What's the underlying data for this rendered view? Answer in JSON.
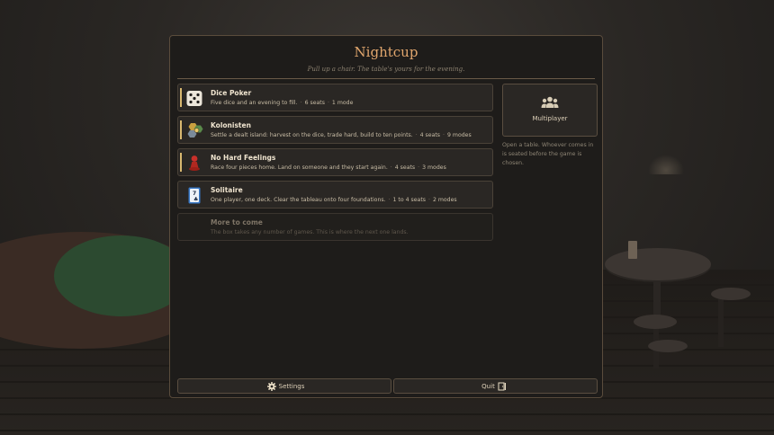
{
  "app": {
    "title": "Nightcup",
    "subtitle": "Pull up a chair. The table's yours for the evening."
  },
  "games": [
    {
      "name": "Dice Poker",
      "description": "Five dice and an evening to fill.",
      "seats": "6 seats",
      "modes": "1 mode",
      "icon": "dice-icon",
      "accent_color": "#d8b870"
    },
    {
      "name": "Kolonisten",
      "description": "Settle a dealt island: harvest on the dice, trade hard, build to ten points.",
      "seats": "4 seats",
      "modes": "9 modes",
      "icon": "hex-tiles-icon",
      "accent_color": "#d8b870"
    },
    {
      "name": "No Hard Feelings",
      "description": "Race four pieces home. Land on someone and they start again.",
      "seats": "4 seats",
      "modes": "3 modes",
      "icon": "pawn-icon",
      "accent_color": "#d8b870"
    },
    {
      "name": "Solitaire",
      "description": "One player, one deck. Clear the tableau onto four foundations.",
      "seats": "1 to 4 seats",
      "modes": "2 modes",
      "icon": "playing-card-icon",
      "accent_color": ""
    }
  ],
  "placeholder": {
    "name": "More to come",
    "description": "The box takes any number of games. This is where the next one lands."
  },
  "multiplayer": {
    "label": "Multiplayer",
    "icon": "people-group-icon",
    "help": "Open a table. Whoever comes in is seated before the game is chosen."
  },
  "footer": {
    "settings_label": "Settings",
    "settings_icon": "gear-icon",
    "quit_label": "Quit",
    "quit_icon": "exit-door-icon"
  },
  "colors": {
    "title": "#e1a66d",
    "accent": "#d8b870",
    "panel_bg": "#1e1c1a",
    "card_bg": "#2a2724",
    "border": "#5a4c3c"
  }
}
